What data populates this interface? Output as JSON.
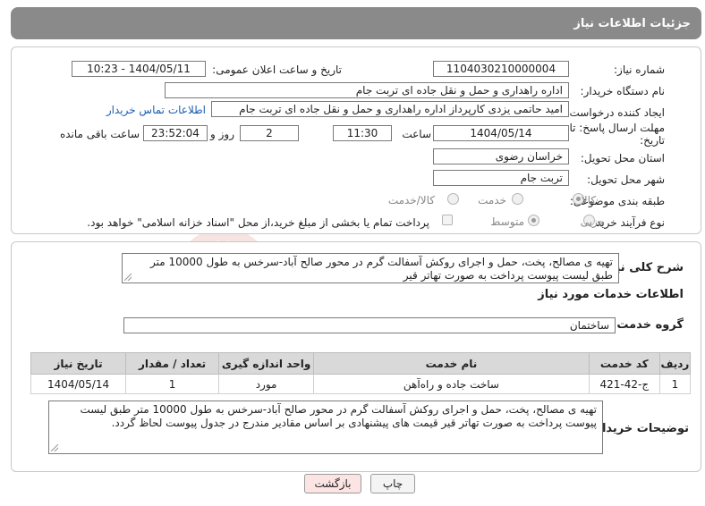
{
  "header": {
    "title": "جزئیات اطلاعات نیاز"
  },
  "form": {
    "need_number_label": "شماره نیاز:",
    "need_number": "1104030210000004",
    "announce_label": "تاریخ و ساعت اعلان عمومی:",
    "announce_value": "1404/05/11 - 10:23",
    "buyer_org_label": "نام دستگاه خریدار:",
    "buyer_org": "اداره راهداری و حمل و نقل جاده ای تربت جام",
    "creator_label": "ایجاد کننده درخواست:",
    "creator": "امید حاتمی یزدی کارپرداز اداره راهداری و حمل و نقل جاده ای تربت جام",
    "contact_link": "اطلاعات تماس خریدار",
    "deadline_label_1": "مهلت ارسال پاسخ: تا",
    "deadline_label_2": "تاریخ:",
    "deadline_date": "1404/05/14",
    "time_label": "ساعت",
    "deadline_time": "11:30",
    "days": "2",
    "days_label": "روز و",
    "remaining_time": "23:52:04",
    "remaining_label": "ساعت باقی مانده",
    "province_label": "استان محل تحویل:",
    "province": "خراسان رضوی",
    "city_label": "شهر محل تحویل:",
    "city": "تربت جام",
    "category_label": "طبقه بندی موضوعی:",
    "category_options": [
      "کالا",
      "خدمت",
      "کالا/خدمت"
    ],
    "purchase_type_label": "نوع فرآیند خرید :",
    "purchase_options": [
      "جزیی",
      "متوسط"
    ],
    "payment_note": "پرداخت تمام یا بخشی از مبلغ خرید،از محل \"اسناد خزانه اسلامی\" خواهد بود."
  },
  "details": {
    "summary_label": "شرح کلی نیاز:",
    "summary": "تهیه ی مصالح، پخت، حمل و اجرای روکش آسفالت گرم در محور صالح آباد-سرخس به طول 10000 متر طبق لیست پیوست پرداخت به صورت تهاتر قیر",
    "services_title": "اطلاعات خدمات مورد نیاز",
    "service_group_label": "گروه خدمت:",
    "service_group": "ساختمان",
    "table": {
      "headers": [
        "ردیف",
        "کد خدمت",
        "نام خدمت",
        "واحد اندازه گیری",
        "تعداد / مقدار",
        "تاریخ نیاز"
      ],
      "rows": [
        [
          "1",
          "ج-42-421",
          "ساخت جاده و راه‌آهن",
          "مورد",
          "1",
          "1404/05/14"
        ]
      ]
    },
    "buyer_notes_label": "توضیحات خریدار:",
    "buyer_notes": "تهیه ی مصالح، پخت، حمل و اجرای روکش آسفالت گرم در محور صالح آباد-سرخس به طول 10000 متر طبق لیست پیوست پرداخت به صورت تهاتر قیر قیمت های پیشنهادی بر اساس مقادیر مندرج در جدول پیوست لحاظ گردد."
  },
  "buttons": {
    "print": "چاپ",
    "back": "بازگشت"
  },
  "watermark": {
    "text": "AriaTender.net"
  }
}
